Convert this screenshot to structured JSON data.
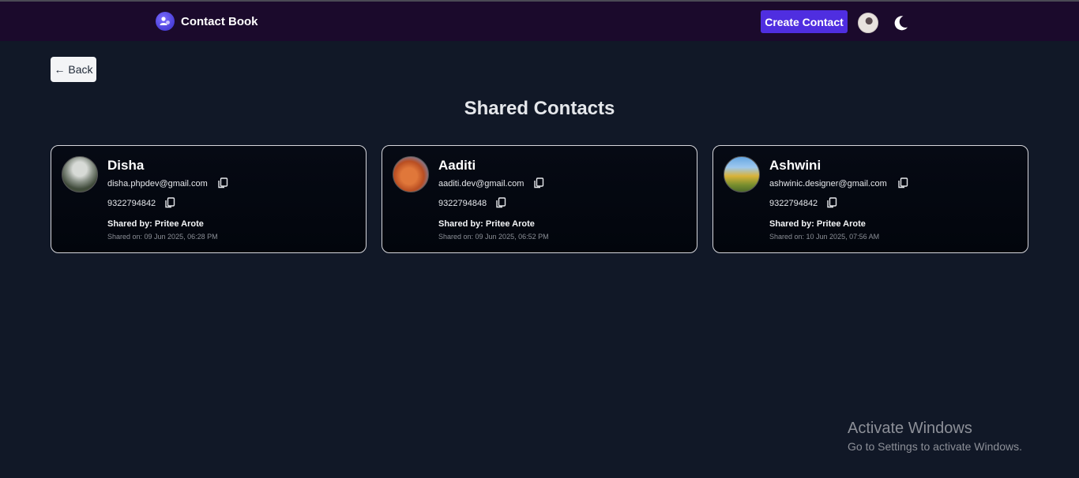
{
  "navbar": {
    "brand_title": "Contact Book",
    "brand_icon": "contact-book-logo-icon",
    "create_button_label": "Create Contact",
    "theme_icon": "moon-icon",
    "accent_color": "#4f2ee0",
    "background_color": "#1b0a2c"
  },
  "back_button_label": "← Back",
  "page_title": "Shared Contacts",
  "contacts": [
    {
      "name": "Disha",
      "email": "disha.phpdev@gmail.com",
      "phone": "9322794842",
      "shared_by": "Shared by: Pritee Arote",
      "shared_on": "Shared on: 09 Jun 2025, 06:28 PM"
    },
    {
      "name": "Aaditi",
      "email": "aaditi.dev@gmail.com",
      "phone": "9322794848",
      "shared_by": "Shared by: Pritee Arote",
      "shared_on": "Shared on: 09 Jun 2025, 06:52 PM"
    },
    {
      "name": "Ashwini",
      "email": "ashwinic.designer@gmail.com",
      "phone": "9322794842",
      "shared_by": "Shared by: Pritee Arote",
      "shared_on": "Shared on: 10 Jun 2025, 07:56 AM"
    }
  ],
  "watermark": {
    "title": "Activate Windows",
    "subtitle": "Go to Settings to activate Windows."
  }
}
